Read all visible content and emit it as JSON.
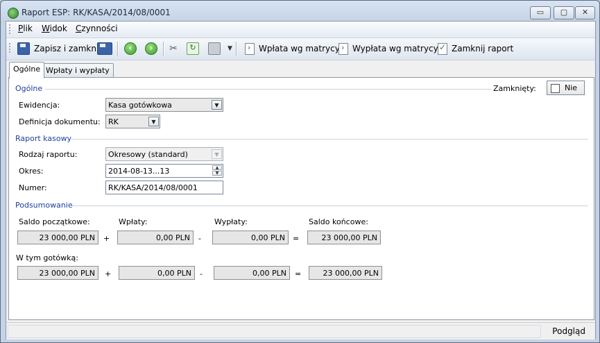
{
  "window": {
    "title": "Raport ESP: RK/KASA/2014/08/0001",
    "controls": {
      "minimize": "▭",
      "maximize": "▢",
      "close": "✕"
    }
  },
  "menu": {
    "items": [
      {
        "label": "Plik",
        "accel": "P",
        "rest": "lik"
      },
      {
        "label": "Widok",
        "accel": "W",
        "rest": "idok"
      },
      {
        "label": "Czynności",
        "accel": "C",
        "rest": "zynności"
      }
    ]
  },
  "toolbar": {
    "save_close": "Zapisz i zamknij",
    "deposit": "Wpłata wg matrycy",
    "withdraw": "Wypłata wg matrycy",
    "close_report": "Zamknij raport",
    "icons": {
      "save": "save-icon",
      "save_as": "save-as-icon",
      "back": "arrow-left-icon",
      "forward": "arrow-right-icon",
      "tools": "tools-icon",
      "refresh": "refresh-icon",
      "print": "print-icon",
      "deposit": "document-icon",
      "withdraw": "document-icon",
      "close_report": "checklist-icon"
    }
  },
  "tabs": [
    {
      "label": "Ogólne",
      "active": true
    },
    {
      "label": "Wpłaty i wypłaty",
      "active": false
    }
  ],
  "general": {
    "section": "Ogólne",
    "closed_label": "Zamknięty:",
    "closed_value": "Nie",
    "evidence_label": "Ewidencja:",
    "evidence_value": "Kasa gotówkowa",
    "docdef_label": "Definicja dokumentu:",
    "docdef_value": "RK"
  },
  "cash_report": {
    "section": "Raport kasowy",
    "type_label": "Rodzaj raportu:",
    "type_value": "Okresowy (standard)",
    "period_label": "Okres:",
    "period_value": "2014-08-13...13",
    "number_label": "Numer:",
    "number_value": "RK/KASA/2014/08/0001"
  },
  "summary": {
    "section": "Podsumowanie",
    "opening_label": "Saldo początkowe:",
    "deposits_label": "Wpłaty:",
    "withdrawals_label": "Wypłaty:",
    "closing_label": "Saldo końcowe:",
    "row1": {
      "opening": "23 000,00 PLN",
      "deposits": "0,00 PLN",
      "withdrawals": "0,00 PLN",
      "closing": "23 000,00 PLN"
    },
    "cash_label": "W tym gotówką:",
    "row2": {
      "opening": "23 000,00 PLN",
      "deposits": "0,00 PLN",
      "withdrawals": "0,00 PLN",
      "closing": "23 000,00 PLN"
    },
    "plus": "+",
    "minus": "-",
    "equals": "="
  },
  "status": {
    "preview": "Podgląd"
  }
}
